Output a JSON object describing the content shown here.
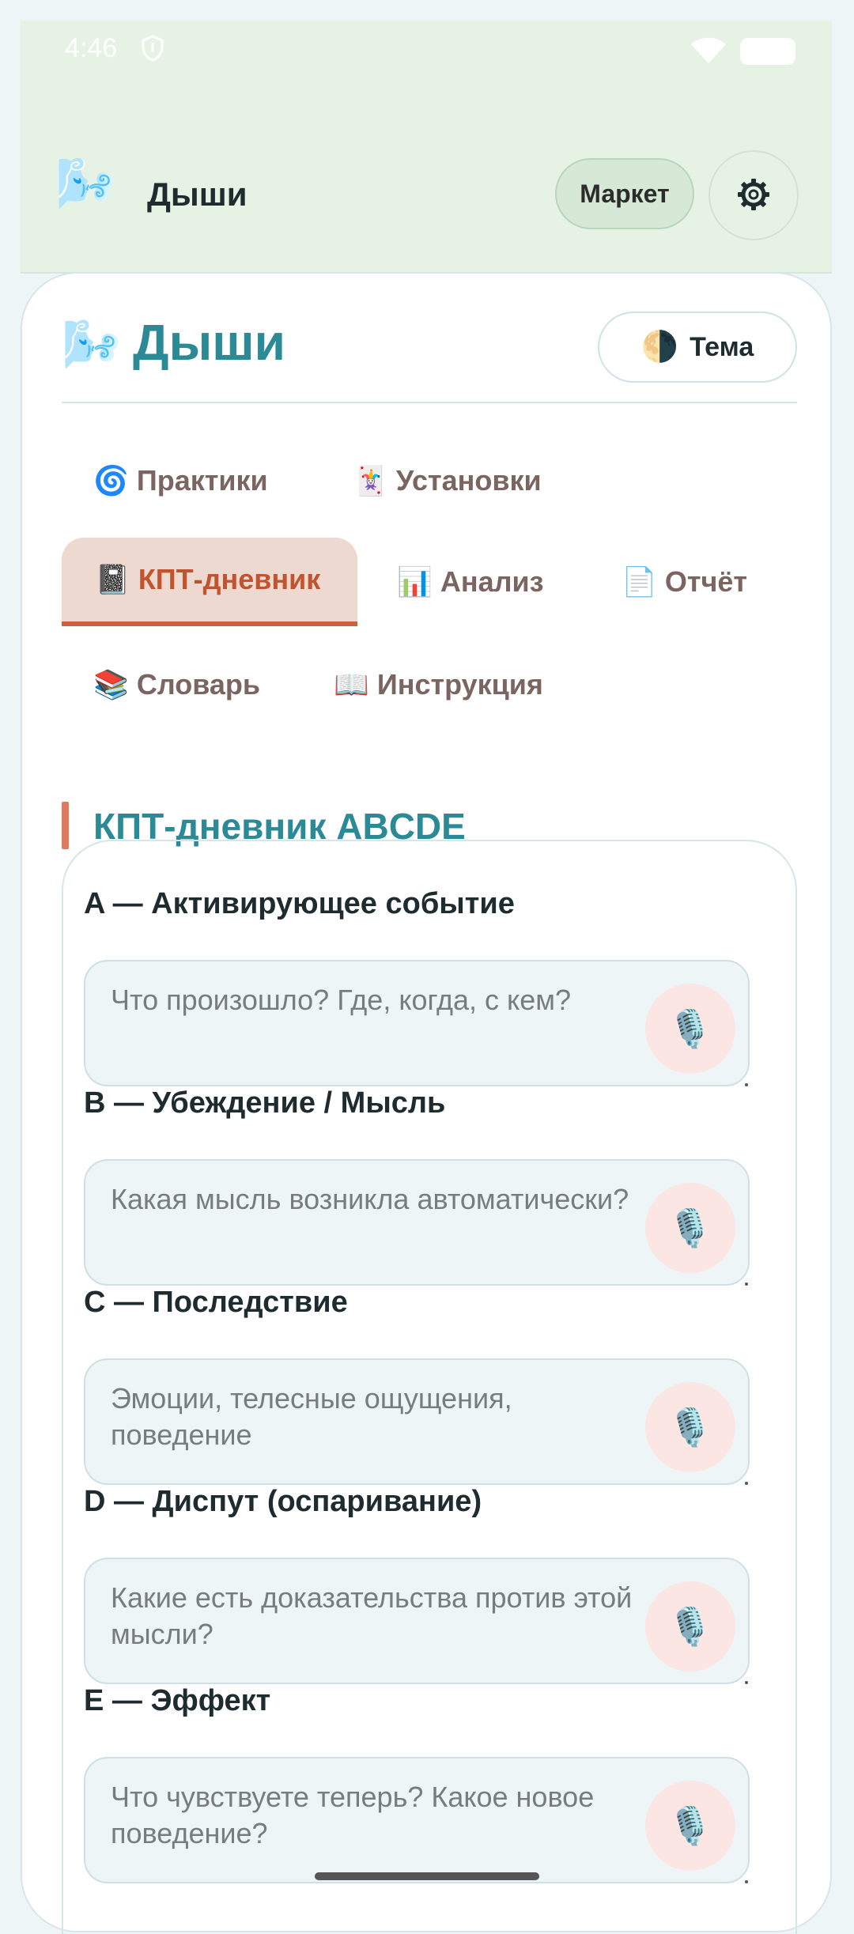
{
  "status_bar": {
    "time": "4:46"
  },
  "app_bar": {
    "logo_emoji": "🌬️",
    "title": "Дыши",
    "market_label": "Маркет",
    "settings_icon": "gear-icon"
  },
  "header": {
    "logo_emoji": "🌬️",
    "title": "Дыши",
    "theme_icon": "🌗",
    "theme_label": "Тема"
  },
  "tabs": [
    {
      "icon": "🌀",
      "label": "Практики",
      "active": false
    },
    {
      "icon": "🃏",
      "label": "Установки",
      "active": false
    },
    {
      "icon": "📓",
      "label": "КПТ-дневник",
      "active": true
    },
    {
      "icon": "📊",
      "label": "Анализ",
      "active": false
    },
    {
      "icon": "📄",
      "label": "Отчёт",
      "active": false
    },
    {
      "icon": "📚",
      "label": "Словарь",
      "active": false
    },
    {
      "icon": "📖",
      "label": "Инструкция",
      "active": false
    }
  ],
  "section": {
    "title": "КПТ-дневник ABCDE"
  },
  "fields": [
    {
      "label": "A — Активирующее событие",
      "placeholder": "Что произошло? Где, когда, с кем?",
      "mic_icon": "🎙️"
    },
    {
      "label": "B — Убеждение / Мысль",
      "placeholder": "Какая мысль возникла автоматически?",
      "mic_icon": "🎙️"
    },
    {
      "label": "C — Последствие",
      "placeholder": "Эмоции, телесные ощущения, поведение",
      "mic_icon": "🎙️"
    },
    {
      "label": "D — Диспут (оспаривание)",
      "placeholder": "Какие есть доказательства против этой мысли?",
      "mic_icon": "🎙️"
    },
    {
      "label": "E — Эффект",
      "placeholder": "Что чувствуете теперь? Какое новое поведение?",
      "mic_icon": "🎙️"
    }
  ],
  "colors": {
    "accent_teal": "#2b8a96",
    "accent_terracotta": "#c2532f",
    "app_bar_bg": "#e6f2e4",
    "mic_bg": "#fbe6e3"
  }
}
